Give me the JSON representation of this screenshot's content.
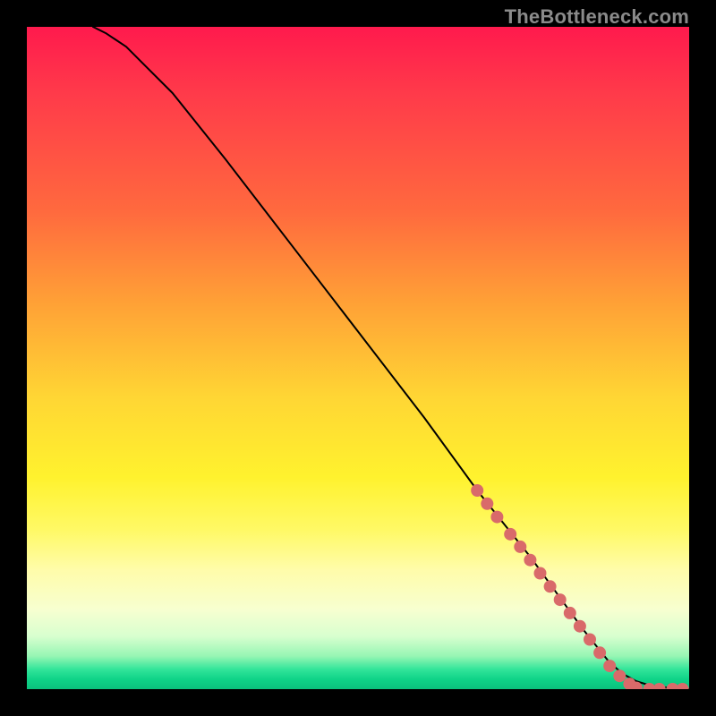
{
  "watermark": "TheBottleneck.com",
  "chart_data": {
    "type": "line",
    "title": "",
    "xlabel": "",
    "ylabel": "",
    "xlim": [
      0,
      100
    ],
    "ylim": [
      0,
      100
    ],
    "grid": false,
    "legend": false,
    "series": [
      {
        "name": "curve",
        "x": [
          10,
          12,
          15,
          18,
          22,
          30,
          40,
          50,
          60,
          68,
          72,
          76,
          80,
          84,
          86,
          88,
          90,
          92,
          94,
          96,
          98,
          100
        ],
        "y": [
          100,
          99,
          97,
          94,
          90,
          80,
          67,
          54,
          41,
          30,
          25,
          20,
          14.5,
          9,
          6.5,
          4,
          2.3,
          1.2,
          0.6,
          0.3,
          0.1,
          0.0
        ]
      }
    ],
    "markers": [
      {
        "x": 68.0,
        "y": 30.0
      },
      {
        "x": 69.5,
        "y": 28.0
      },
      {
        "x": 71.0,
        "y": 26.0
      },
      {
        "x": 73.0,
        "y": 23.4
      },
      {
        "x": 74.5,
        "y": 21.5
      },
      {
        "x": 76.0,
        "y": 19.5
      },
      {
        "x": 77.5,
        "y": 17.5
      },
      {
        "x": 79.0,
        "y": 15.5
      },
      {
        "x": 80.5,
        "y": 13.5
      },
      {
        "x": 82.0,
        "y": 11.5
      },
      {
        "x": 83.5,
        "y": 9.5
      },
      {
        "x": 85.0,
        "y": 7.5
      },
      {
        "x": 86.5,
        "y": 5.5
      },
      {
        "x": 88.0,
        "y": 3.5
      },
      {
        "x": 89.5,
        "y": 2.0
      },
      {
        "x": 91.0,
        "y": 0.8
      },
      {
        "x": 92.0,
        "y": 0.2
      },
      {
        "x": 94.0,
        "y": 0.0
      },
      {
        "x": 95.5,
        "y": 0.0
      },
      {
        "x": 97.5,
        "y": 0.0
      },
      {
        "x": 99.0,
        "y": 0.0
      }
    ],
    "marker_radius": 7
  }
}
